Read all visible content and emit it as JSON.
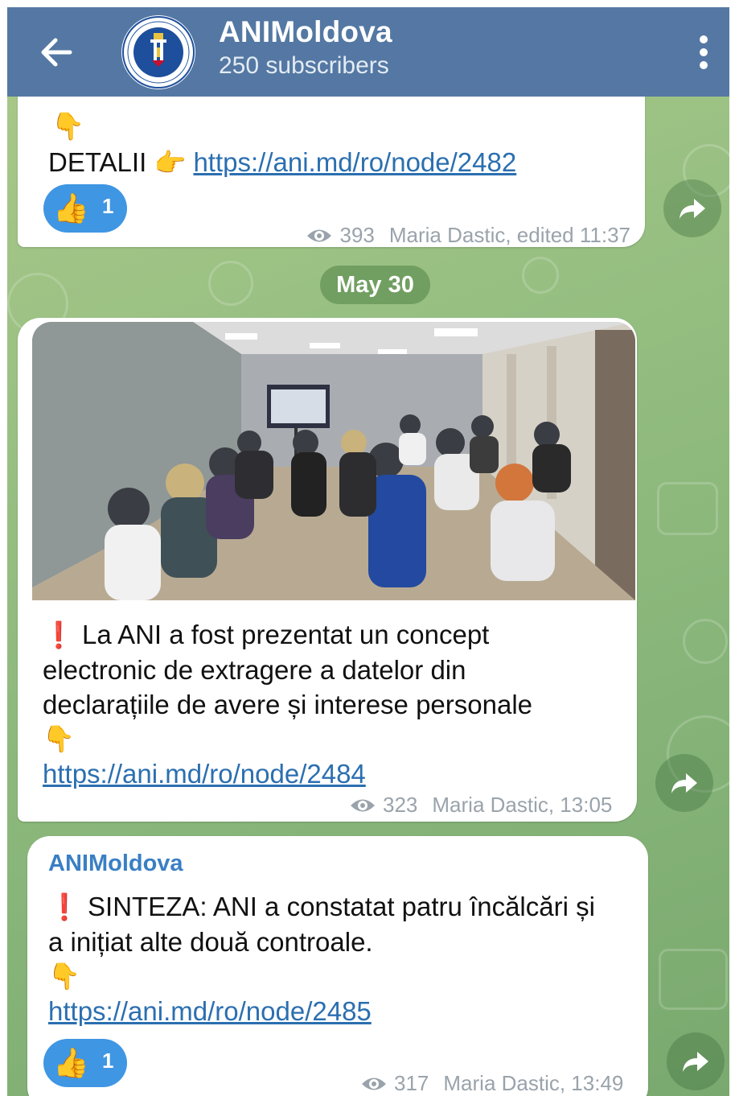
{
  "header": {
    "title": "ANIMoldova",
    "subtitle": "250 subscribers",
    "avatar_text": "AUTORITATEA NAȚIONALĂ DE INTEGRITATE"
  },
  "messages": [
    {
      "detail_label": "DETALII",
      "link": "https://ani.md/ro/node/2482",
      "reaction_emoji": "👍",
      "reaction_count": "1",
      "views": "393",
      "meta": "Maria Dastic, edited 11:37"
    },
    {
      "text_line1": "La ANI a fost prezentat un concept",
      "text_line2": "electronic de extragere a datelor din",
      "text_line3": "declarațiile de avere și interese personale",
      "link": "https://ani.md/ro/node/2484",
      "views": "323",
      "meta": "Maria Dastic, 13:05"
    },
    {
      "sender": "ANIMoldova",
      "text_line1": "SINTEZA: ANI a constatat patru încălcări și",
      "text_line2": "a inițiat alte două controale.",
      "link": "https://ani.md/ro/node/2485",
      "reaction_emoji": "👍",
      "reaction_count": "1",
      "views": "317",
      "meta": "Maria Dastic, 13:49"
    }
  ],
  "date_separator": "May 30",
  "emoji": {
    "pointing_down": "👇",
    "pointing_right": "👉",
    "exclamation": "❗"
  },
  "colors": {
    "header_bg": "#5478a3",
    "link": "#2b6fb0",
    "reaction_bg": "#3f96e3",
    "sender_name": "#3a7fc4"
  }
}
